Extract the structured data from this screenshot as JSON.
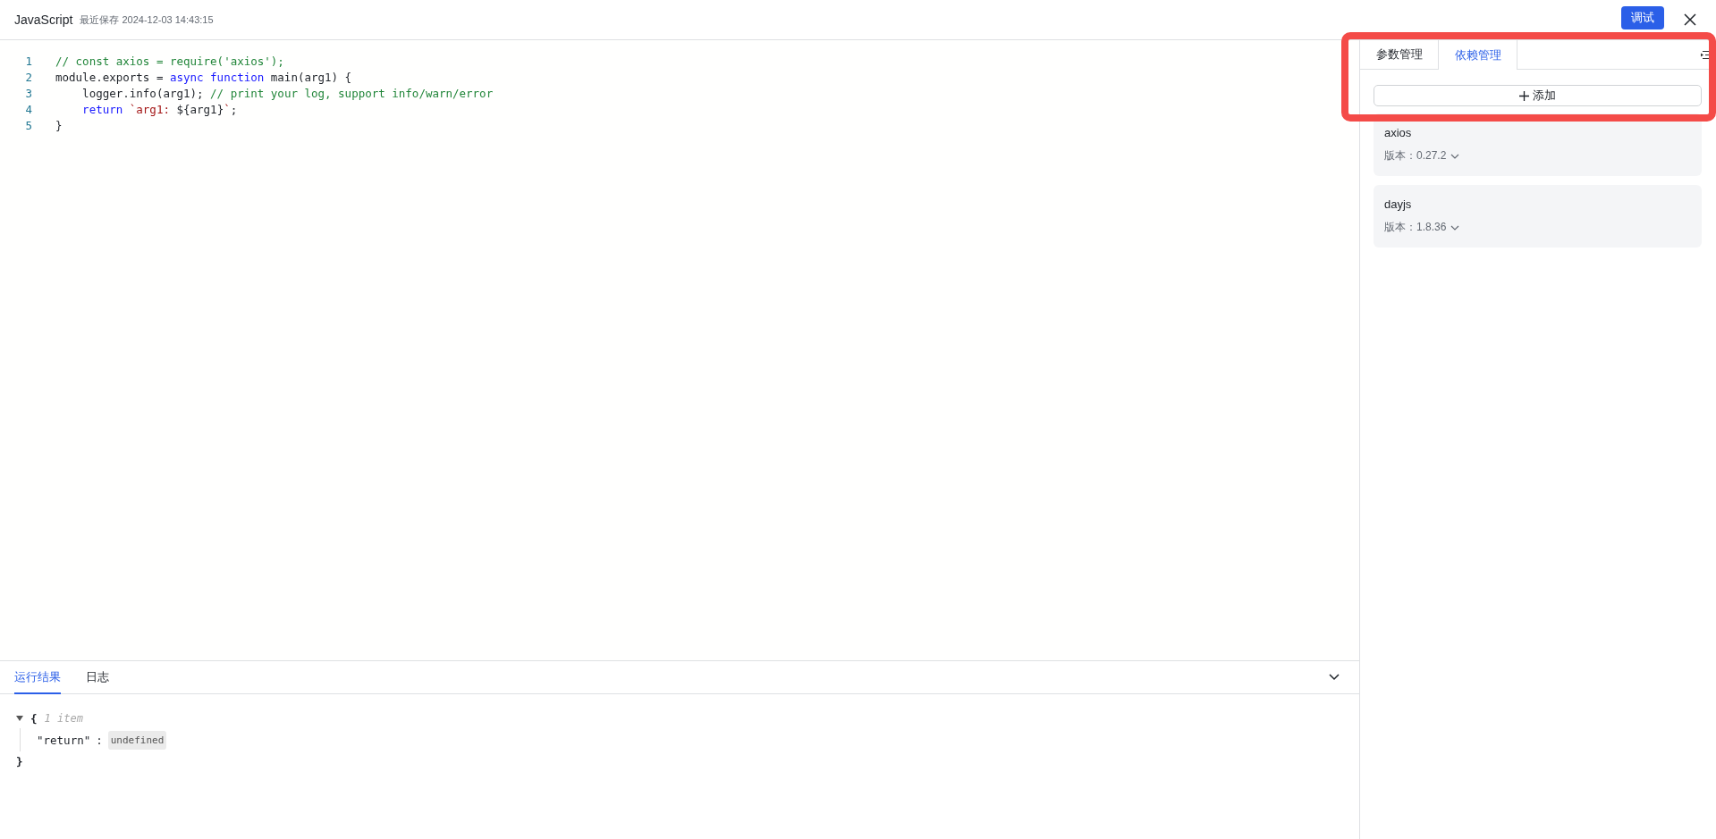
{
  "header": {
    "title": "JavaScript",
    "saved": "最近保存 2024-12-03 14:43:15",
    "debug_button": "调试"
  },
  "editor": {
    "lines": [
      {
        "number": "1",
        "tokens": [
          {
            "kind": "comment",
            "text": "// const axios = require('axios');"
          }
        ]
      },
      {
        "number": "2",
        "tokens": [
          {
            "kind": "plain",
            "text": "module.exports = "
          },
          {
            "kind": "keyword",
            "text": "async function"
          },
          {
            "kind": "plain",
            "text": " main(arg1) {"
          }
        ]
      },
      {
        "number": "3",
        "tokens": [
          {
            "kind": "plain",
            "text": "    logger.info(arg1); "
          },
          {
            "kind": "comment",
            "text": "// print your log, support info/warn/error"
          }
        ]
      },
      {
        "number": "4",
        "tokens": [
          {
            "kind": "keyword",
            "text": "    return"
          },
          {
            "kind": "string",
            "text": " `arg1: "
          },
          {
            "kind": "plain",
            "text": "${arg1}"
          },
          {
            "kind": "string",
            "text": "`"
          },
          {
            "kind": "plain",
            "text": ";"
          }
        ]
      },
      {
        "number": "5",
        "tokens": [
          {
            "kind": "plain",
            "text": "}"
          }
        ]
      }
    ]
  },
  "output": {
    "tabs": [
      {
        "label": "运行结果",
        "selected": true
      },
      {
        "label": "日志",
        "selected": false
      }
    ],
    "json_view": {
      "expanded": true,
      "open": "{",
      "count": "1 item",
      "key": "\"return\"",
      "colon": ":",
      "value": "undefined",
      "close": "}"
    }
  },
  "side_panel": {
    "tabs": [
      {
        "label": "参数管理",
        "selected": false
      },
      {
        "label": "依赖管理",
        "selected": true
      }
    ],
    "add_button": "添加",
    "dependencies": [
      {
        "name": "axios",
        "version": "版本：0.27.2"
      },
      {
        "name": "dayjs",
        "version": "版本：1.8.36"
      }
    ]
  },
  "annotation": {
    "kind": "highlight",
    "color": "#f44b48"
  }
}
